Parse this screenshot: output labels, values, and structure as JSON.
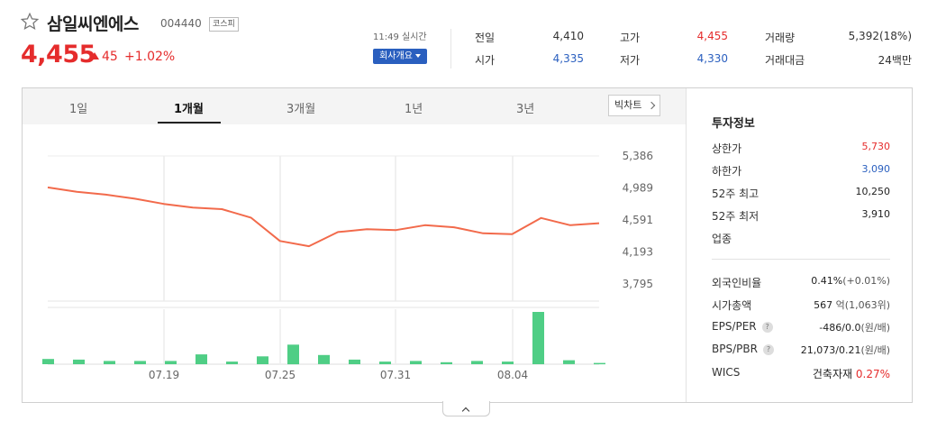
{
  "stock": {
    "name": "삼일씨엔에스",
    "code": "004440",
    "market": "코스피",
    "price": "4,455",
    "change": "45",
    "change_pct": "+1.02%",
    "time": "11:49 실시간",
    "company_btn": "회사개요"
  },
  "quote": {
    "prev_label": "전일",
    "prev_val": "4,410",
    "open_label": "시가",
    "open_val": "4,335",
    "high_label": "고가",
    "high_val": "4,455",
    "low_label": "저가",
    "low_val": "4,330",
    "volume_label": "거래량",
    "volume_val": "5,392(18%)",
    "amount_label": "거래대금",
    "amount_val": "24백만"
  },
  "tabs": [
    "1일",
    "1개월",
    "3개월",
    "1년",
    "3년"
  ],
  "active_tab": "1개월",
  "bigchart_label": "빅차트",
  "chart_data": {
    "type": "line",
    "y_ticks": [
      "5,386",
      "4,989",
      "4,591",
      "4,193",
      "3,795"
    ],
    "x_ticks": [
      "07.19",
      "07.25",
      "07.31",
      "08.04"
    ],
    "series": [
      {
        "values": [
          4995,
          4940,
          4905,
          4855,
          4790,
          4745,
          4725,
          4620,
          4330,
          4265,
          4440,
          4475,
          4465,
          4525,
          4500,
          4425,
          4415,
          4615,
          4525,
          4550
        ]
      },
      {
        "values": [
          8,
          7,
          5,
          5,
          5,
          15,
          4,
          12,
          30,
          14,
          7,
          4,
          5,
          3,
          5,
          4,
          80,
          6,
          2
        ]
      }
    ],
    "colors": {
      "line": "#f26a4b",
      "volume": "#4fce85"
    }
  },
  "info": {
    "title": "투자정보",
    "upper_label": "상한가",
    "upper_val": "5,730",
    "lower_label": "하한가",
    "lower_val": "3,090",
    "high52_label": "52주 최고",
    "high52_val": "10,250",
    "low52_label": "52주 최저",
    "low52_val": "3,910",
    "sector_label": "업종",
    "foreign_label": "외국인비율",
    "foreign_val": "0.41%",
    "foreign_sub": "(+0.01%)",
    "mcap_label": "시가총액",
    "mcap_val": "567",
    "mcap_sub": "억(1,063위)",
    "eps_label": "EPS/PER",
    "eps_val": "-486/0.0",
    "eps_sub": "(원/배)",
    "bps_label": "BPS/PBR",
    "bps_val": "21,073/0.21",
    "bps_sub": "(원/배)",
    "wics_label": "WICS",
    "wics_val": "건축자재",
    "wics_pct": "0.27%"
  }
}
